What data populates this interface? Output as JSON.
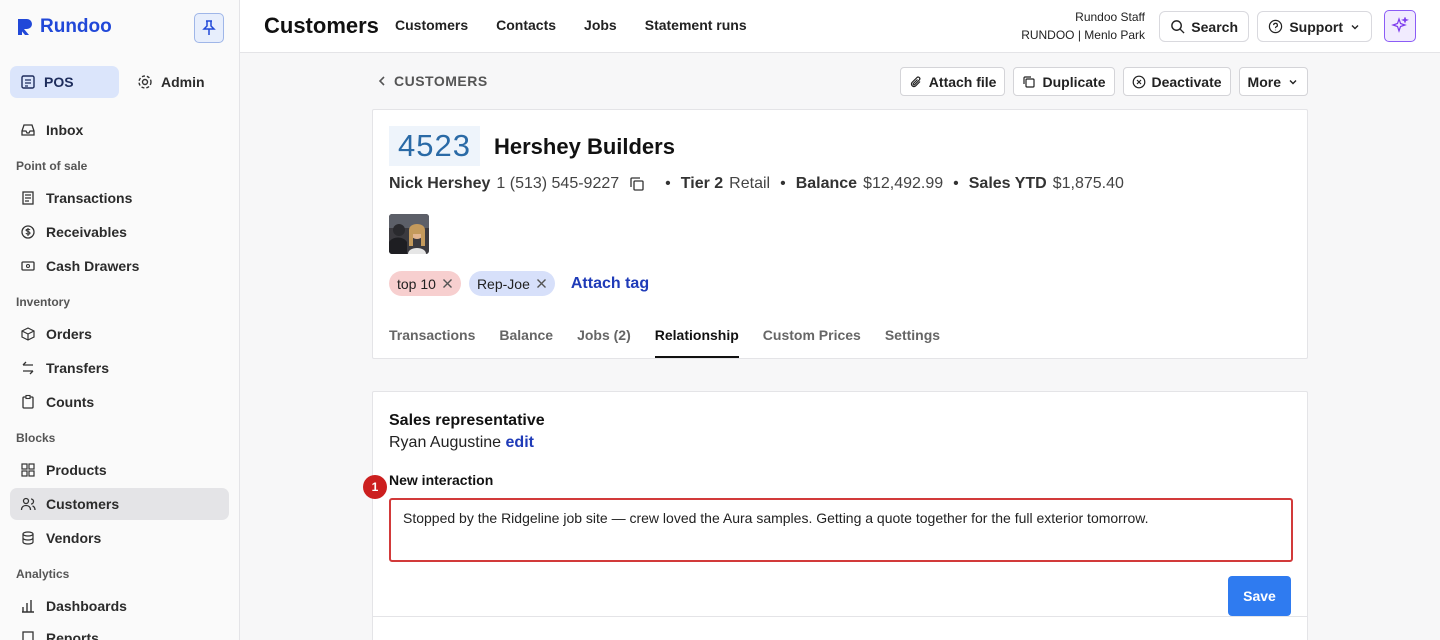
{
  "brand": {
    "name": "Rundoo"
  },
  "sidebar": {
    "modes": [
      {
        "label": "POS",
        "icon": "pos-icon",
        "active": true
      },
      {
        "label": "Admin",
        "icon": "gear-icon",
        "active": false
      }
    ],
    "inbox": "Inbox",
    "sections": {
      "point_of_sale": "Point of sale",
      "inventory": "Inventory",
      "blocks": "Blocks",
      "analytics": "Analytics"
    },
    "items": {
      "transactions": "Transactions",
      "receivables": "Receivables",
      "cash_drawers": "Cash Drawers",
      "orders": "Orders",
      "transfers": "Transfers",
      "counts": "Counts",
      "products": "Products",
      "customers": "Customers",
      "vendors": "Vendors",
      "dashboards": "Dashboards",
      "reports": "Reports"
    }
  },
  "topbar": {
    "title": "Customers",
    "tabs": [
      "Customers",
      "Contacts",
      "Jobs",
      "Statement runs"
    ],
    "user_name": "Rundoo Staff",
    "store": "RUNDOO | Menlo Park",
    "search_label": "Search",
    "support_label": "Support"
  },
  "breadcrumb": {
    "label": "CUSTOMERS"
  },
  "actions": {
    "attach_file": "Attach file",
    "duplicate": "Duplicate",
    "deactivate": "Deactivate",
    "more": "More"
  },
  "customer": {
    "number": "4523",
    "name": "Hershey Builders",
    "contact_name": "Nick Hershey",
    "phone": "1 (513) 545-9227",
    "tier_label": "Tier 2",
    "tier_type": "Retail",
    "balance_label": "Balance",
    "balance": "$12,492.99",
    "sales_ytd_label": "Sales YTD",
    "sales_ytd": "$1,875.40",
    "tags": [
      {
        "label": "top 10",
        "color": "#f7cfcf"
      },
      {
        "label": "Rep-Joe",
        "color": "#d7e0fa"
      }
    ],
    "attach_tag": "Attach tag"
  },
  "subtabs": [
    "Transactions",
    "Balance",
    "Jobs (2)",
    "Relationship",
    "Custom Prices",
    "Settings"
  ],
  "active_subtab": "Relationship",
  "relationship": {
    "sales_rep_label": "Sales representative",
    "sales_rep": "Ryan Augustine",
    "edit": "edit",
    "new_interaction_label": "New interaction",
    "new_interaction_value": "Stopped by the Ridgeline job site — crew loved the Aura samples. Getting a quote together for the full exterior tomorrow.",
    "annotation_badge": "1",
    "save": "Save"
  },
  "colors": {
    "brand": "#2148d8",
    "link": "#1f3bb8",
    "primary": "#2f7bf0",
    "error": "#d23a3a",
    "accent": "#8b5cf6"
  }
}
